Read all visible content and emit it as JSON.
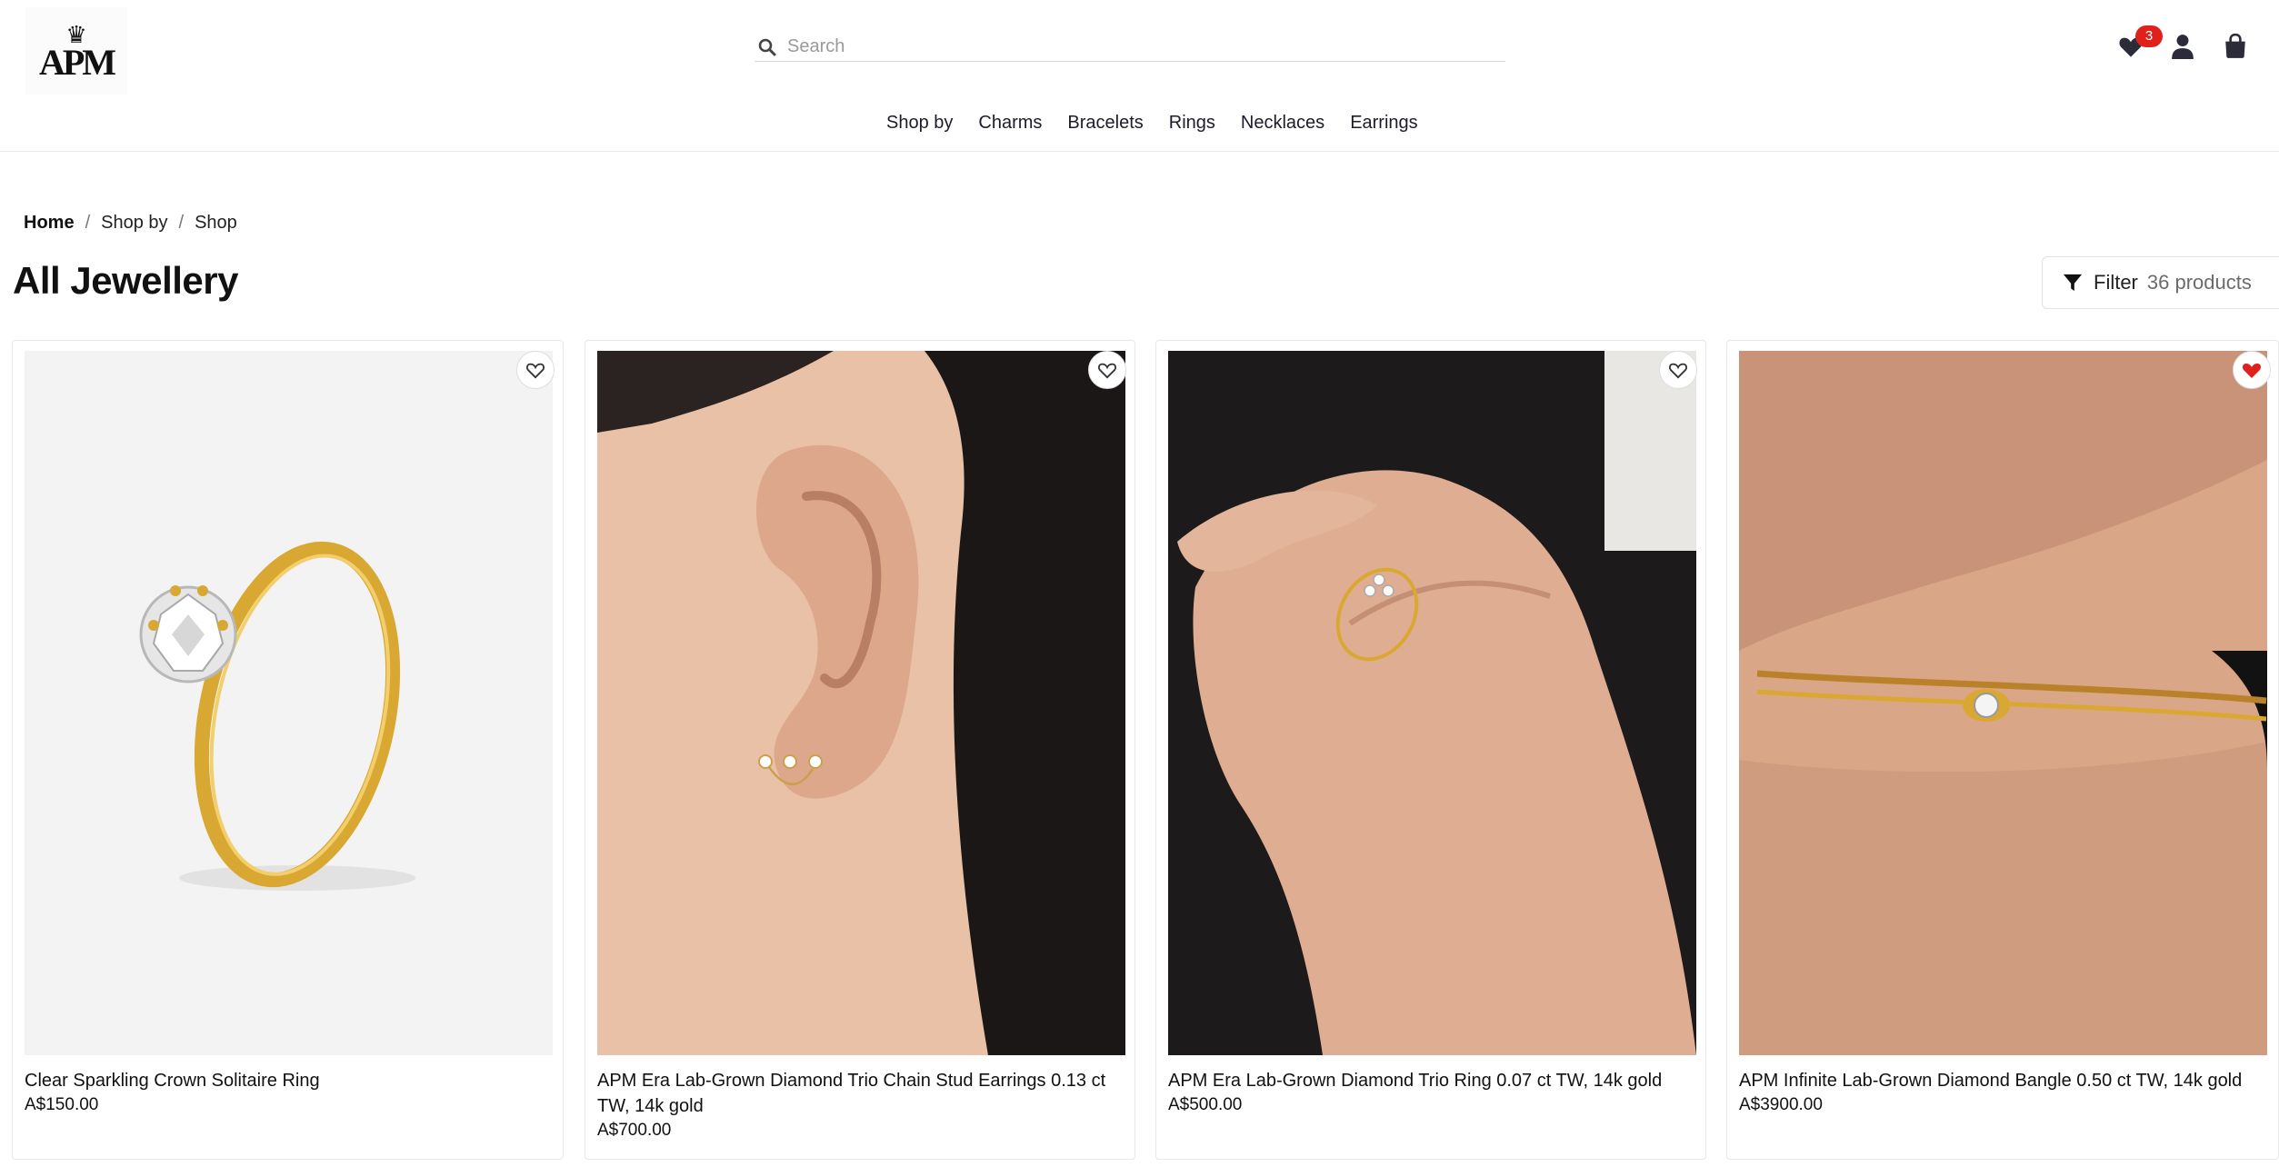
{
  "header": {
    "logo_text": "APM",
    "search_placeholder": "Search",
    "wishlist_count": "3"
  },
  "nav": {
    "items": [
      "Shop by",
      "Charms",
      "Bracelets",
      "Rings",
      "Necklaces",
      "Earrings"
    ]
  },
  "breadcrumb": {
    "home": "Home",
    "level1": "Shop by",
    "level2": "Shop",
    "separator": "/"
  },
  "page": {
    "title": "All Jewellery",
    "filter_label": "Filter",
    "product_count": "36 products"
  },
  "products": [
    {
      "name": "Clear Sparkling Crown Solitaire Ring",
      "price": "A$150.00",
      "wishlisted": false,
      "image": "gold-solitaire-ring"
    },
    {
      "name": "APM Era Lab-Grown Diamond Trio Chain Stud Earrings 0.13 ct TW, 14k gold",
      "price": "A$700.00",
      "wishlisted": false,
      "image": "ear-with-chain-stud-earring"
    },
    {
      "name": "APM Era Lab-Grown Diamond Trio Ring 0.07 ct TW, 14k gold",
      "price": "A$500.00",
      "wishlisted": false,
      "image": "hand-wearing-trio-ring"
    },
    {
      "name": "APM Infinite Lab-Grown Diamond Bangle 0.50 ct TW, 14k gold",
      "price": "A$3900.00",
      "wishlisted": true,
      "image": "wrist-wearing-bangle"
    }
  ],
  "colors": {
    "accent_red": "#e0201b",
    "gold": "#d9a832",
    "text": "#111111"
  }
}
